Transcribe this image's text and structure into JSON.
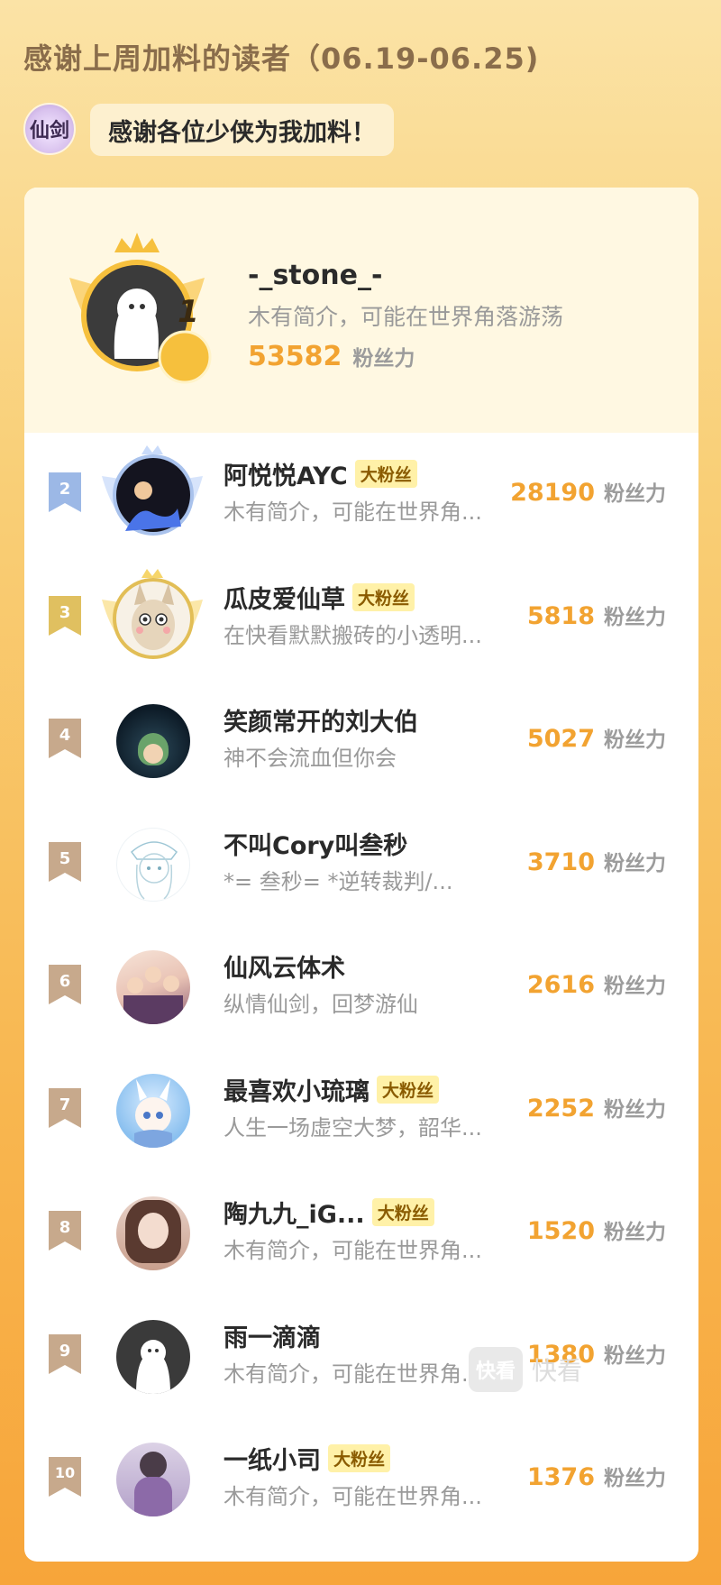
{
  "header": {
    "title": "感谢上周加料的读者（06.19-06.25)"
  },
  "speaker": {
    "avatar_text": "仙剑",
    "message": "感谢各位少侠为我加料！"
  },
  "top_reader": {
    "rank": "1",
    "name": "-_stone_-",
    "bio": "木有简介，可能在世界角落游荡",
    "score": "53582",
    "score_unit": "粉丝力"
  },
  "readers": [
    {
      "rank": "2",
      "name": "阿悦悦AYC",
      "fan_badge": "大粉丝",
      "bio": "木有简介，可能在世界角...",
      "score": "28190",
      "score_unit": "粉丝力"
    },
    {
      "rank": "3",
      "name": "瓜皮爱仙草",
      "fan_badge": "大粉丝",
      "bio": "在快看默默搬砖的小透明...",
      "score": "5818",
      "score_unit": "粉丝力"
    },
    {
      "rank": "4",
      "name": "笑颜常开的刘大伯",
      "fan_badge": "",
      "bio": "神不会流血但你会",
      "score": "5027",
      "score_unit": "粉丝力"
    },
    {
      "rank": "5",
      "name": "不叫Cory叫叁秒",
      "fan_badge": "",
      "bio": "*= 叁秒= *逆转裁判/...",
      "score": "3710",
      "score_unit": "粉丝力"
    },
    {
      "rank": "6",
      "name": "仙风云体术",
      "fan_badge": "",
      "bio": "纵情仙剑，回梦游仙",
      "score": "2616",
      "score_unit": "粉丝力"
    },
    {
      "rank": "7",
      "name": "最喜欢小琉璃",
      "fan_badge": "大粉丝",
      "bio": "人生一场虚空大梦，韶华...",
      "score": "2252",
      "score_unit": "粉丝力"
    },
    {
      "rank": "8",
      "name": "陶九九_iG...",
      "fan_badge": "大粉丝",
      "bio": "木有简介，可能在世界角...",
      "score": "1520",
      "score_unit": "粉丝力"
    },
    {
      "rank": "9",
      "name": "雨一滴滴",
      "fan_badge": "",
      "bio": "木有简介，可能在世界角...",
      "score": "1380",
      "score_unit": "粉丝力"
    },
    {
      "rank": "10",
      "name": "一纸小司",
      "fan_badge": "大粉丝",
      "bio": "木有简介，可能在世界角...",
      "score": "1376",
      "score_unit": "粉丝力"
    }
  ],
  "watermark": {
    "logo_text": "快看",
    "text": "快看"
  },
  "colors": {
    "score": "#f2a331",
    "rank2": "#9cb8e6",
    "rank3": "#e0c060",
    "rank_other": "#c7a98c",
    "fan_badge_bg": "#fff1a8"
  },
  "icons": {
    "rank_tag": "ribbon-tag-icon",
    "crown": "crown-icon",
    "wings": "wings-icon"
  }
}
